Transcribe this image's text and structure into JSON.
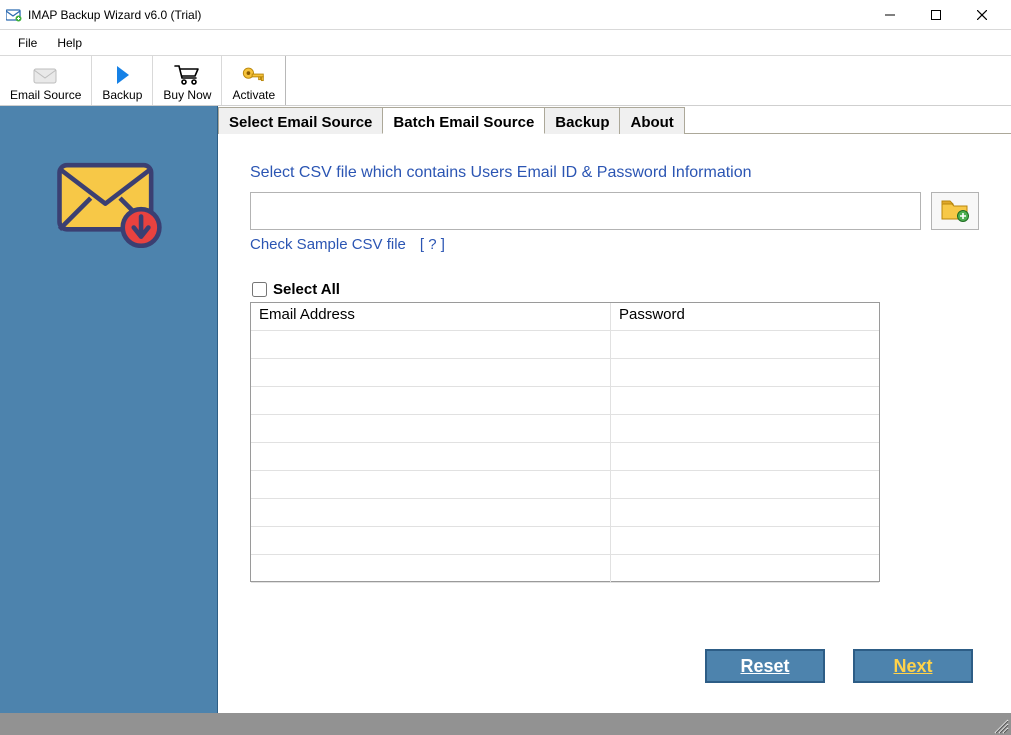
{
  "window": {
    "title": "IMAP Backup Wizard v6.0 (Trial)"
  },
  "menu": {
    "file": "File",
    "help": "Help"
  },
  "toolbar": {
    "email_source": "Email Source",
    "backup": "Backup",
    "buy_now": "Buy Now",
    "activate": "Activate"
  },
  "tabs": {
    "select_email_source": "Select Email Source",
    "batch_email_source": "Batch Email Source",
    "backup": "Backup",
    "about": "About"
  },
  "batch_panel": {
    "instruction": "Select CSV file which contains Users Email ID & Password Information",
    "csv_path": "",
    "check_sample": "Check Sample CSV file",
    "help_mark": "[ ? ]",
    "select_all": "Select All",
    "columns": {
      "email": "Email Address",
      "password": "Password"
    },
    "reset": "Reset",
    "next": "Next"
  }
}
